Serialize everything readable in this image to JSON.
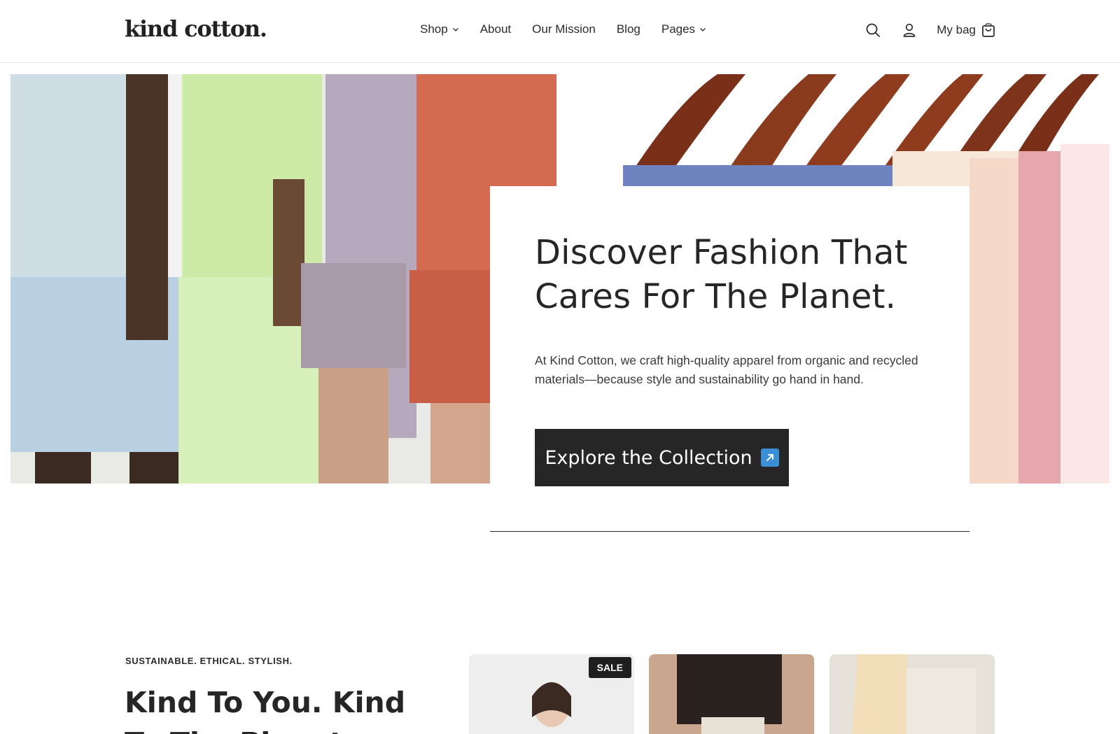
{
  "header": {
    "logo": "kind cotton.",
    "nav": [
      {
        "label": "Shop",
        "has_dropdown": true
      },
      {
        "label": "About",
        "has_dropdown": false
      },
      {
        "label": "Our Mission",
        "has_dropdown": false
      },
      {
        "label": "Blog",
        "has_dropdown": false
      },
      {
        "label": "Pages",
        "has_dropdown": true
      }
    ],
    "bag_label": "My bag",
    "icons": [
      "search-icon",
      "account-icon",
      "shopping-bag-icon"
    ]
  },
  "hero": {
    "title": "Discover Fashion That Cares For The Planet.",
    "description": "At Kind Cotton, we craft high-quality apparel from organic and recycled materials—because style and sustainability go hand in hand.",
    "cta_label": "Explore the Collection",
    "cta_icon": "arrow-up-right-icon",
    "cta_icon_color": "#3a8fd6"
  },
  "intro": {
    "eyebrow": "SUSTAINABLE. ETHICAL. STYLISH.",
    "title": "Kind To You. Kind To The Planet."
  },
  "products": [
    {
      "badge": "SALE"
    },
    {
      "badge": ""
    },
    {
      "badge": ""
    }
  ],
  "colors": {
    "text": "#262626",
    "button_bg": "#262626",
    "background": "#ffffff"
  }
}
